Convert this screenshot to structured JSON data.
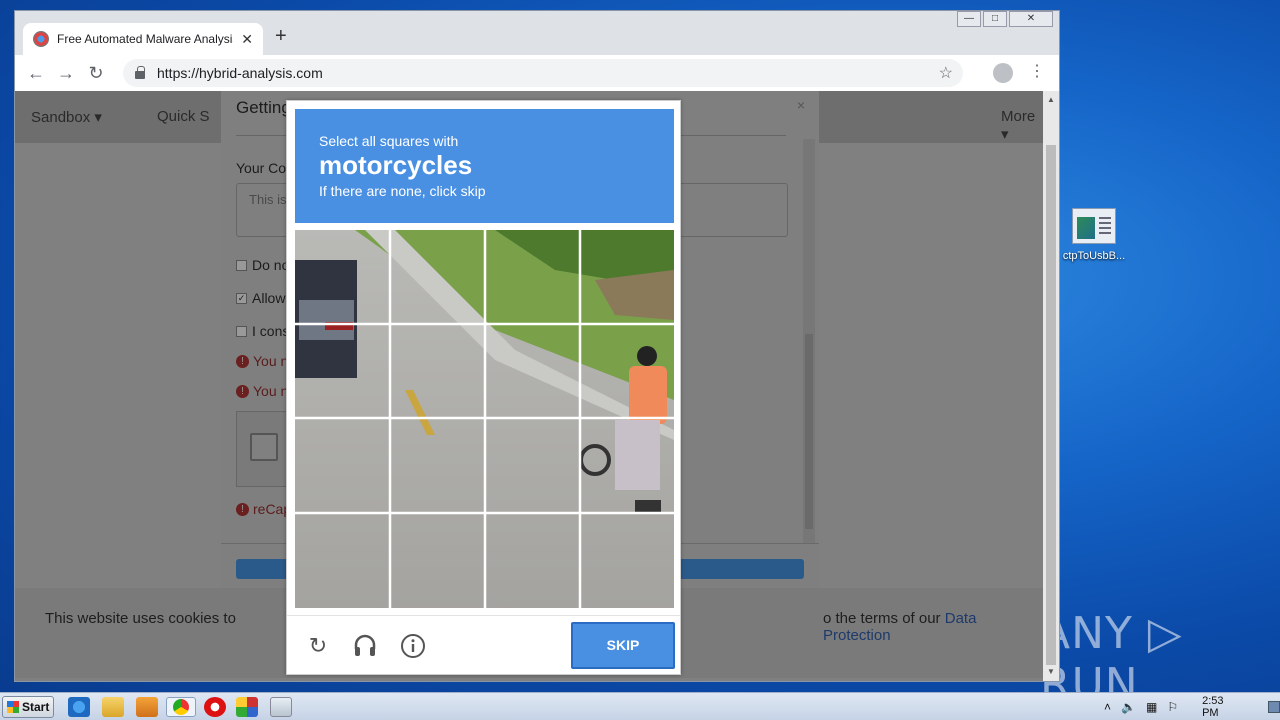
{
  "browser": {
    "tab_title": "Free Automated Malware Analysis Se",
    "url": "https://hybrid-analysis.com",
    "new_tab": "+",
    "tab_close": "✕"
  },
  "window_controls": {
    "minimize": "—",
    "maximize": "□",
    "close": "✕"
  },
  "site_nav": {
    "sandbox": "Sandbox ▾",
    "quick": "Quick S",
    "more": "More ▾"
  },
  "modal": {
    "title": "Getting Things Ready",
    "close": "×",
    "comment_label": "Your Com",
    "comment_placeholder": "This is",
    "checkbox_1": "Do no",
    "checkbox_2": "Allow",
    "checkbox_3": "I cons",
    "error_1": "You n",
    "error_2": "You n",
    "error_3": "reCap"
  },
  "cookie": {
    "left_text": "This website uses cookies to",
    "right_text": "o the terms of our ",
    "link": "Data Protection"
  },
  "captcha": {
    "instruction_line1": "Select all squares with",
    "target": "motorcycles",
    "instruction_line3": "If there are none, click skip",
    "skip_label": "SKIP"
  },
  "desktop": {
    "icon_label": "ctpToUsbB...",
    "watermark": "ANY ▷ RUN"
  },
  "taskbar": {
    "start_label": "Start",
    "clock": "2:53 PM"
  }
}
